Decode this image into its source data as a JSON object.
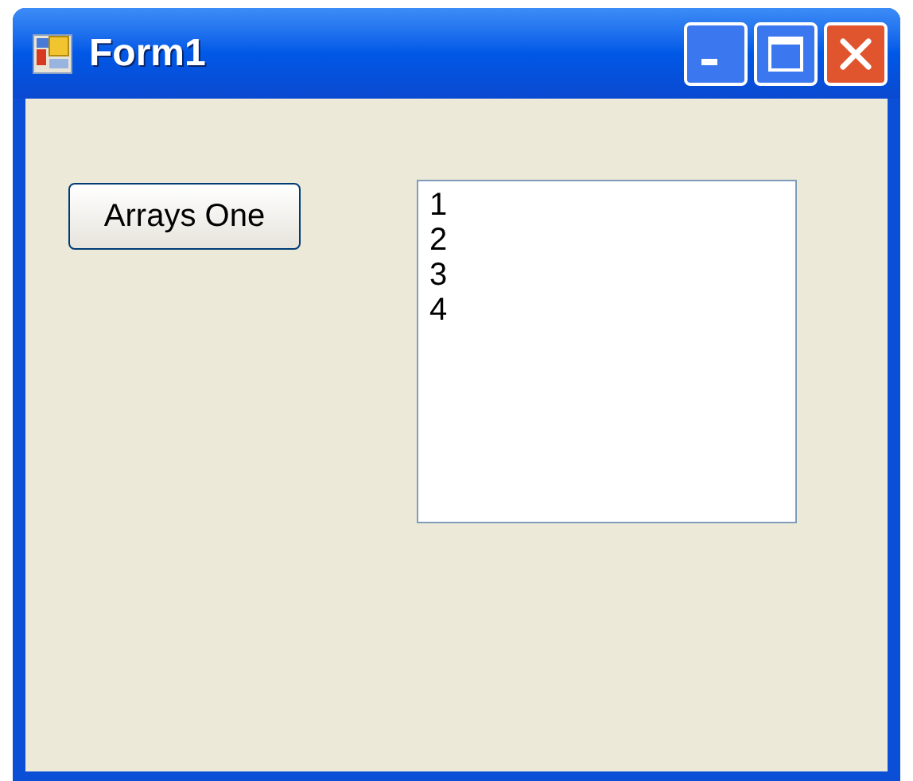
{
  "window": {
    "title": "Form1"
  },
  "title_buttons": [
    {
      "kind": "minimize"
    },
    {
      "kind": "maximize"
    },
    {
      "kind": "close"
    }
  ],
  "button": {
    "label": "Arrays One"
  },
  "listbox": {
    "items": [
      "1",
      "2",
      "3",
      "4"
    ]
  }
}
